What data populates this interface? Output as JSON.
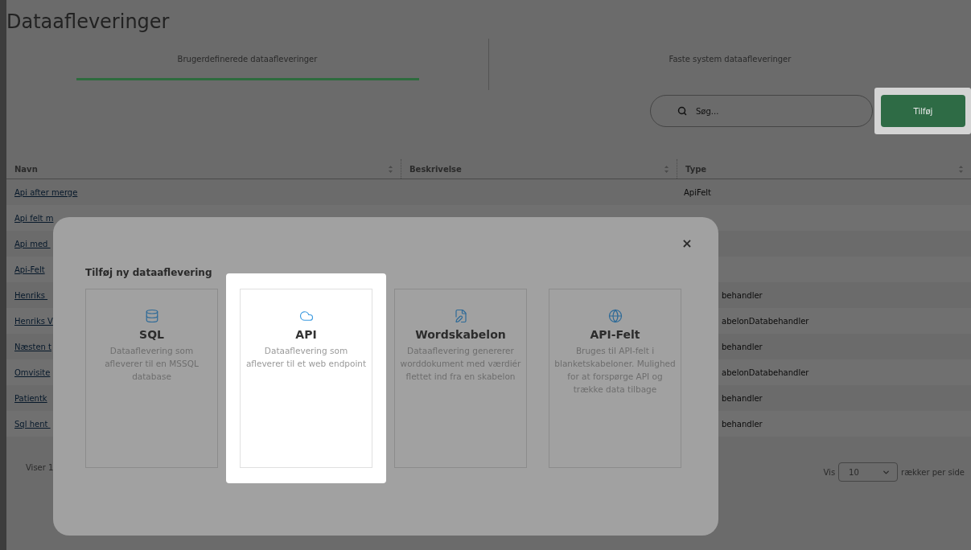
{
  "page": {
    "title": "Dataafleveringer"
  },
  "tabs": [
    {
      "label": "Brugerdefinerede dataafleveringer",
      "selected": true
    },
    {
      "label": "Faste system dataafleveringer",
      "selected": false
    }
  ],
  "search": {
    "placeholder": "Søg..."
  },
  "add_button": {
    "label": "Tilføj",
    "highlighted": true
  },
  "table": {
    "columns": [
      "Navn",
      "Beskrivelse",
      "Type"
    ],
    "rows": [
      {
        "name": "Api after merge",
        "type": "ApiFelt",
        "type_cut": false
      },
      {
        "name": "Api felt m"
      },
      {
        "name": "Api med "
      },
      {
        "name": "Api-Felt"
      },
      {
        "name": "Henriks ",
        "type": "behandler",
        "type_cut": true
      },
      {
        "name": "Henriks V",
        "type": "abelonDatabehandler",
        "type_cut": true
      },
      {
        "name": "Næsten t",
        "type": "behandler",
        "type_cut": true
      },
      {
        "name": "Omvisite",
        "type": "abelonDatabehandler",
        "type_cut": true
      },
      {
        "name": "Patientk",
        "type": "behandler",
        "type_cut": true
      },
      {
        "name": "Sql hent ",
        "type": "behandler",
        "type_cut": true
      }
    ]
  },
  "footer": {
    "showing": "Viser 1",
    "show_label": "Vis",
    "page_size": "10",
    "per_page_label": "rækker per side"
  },
  "dialog": {
    "title": "Tilføj ny dataaflevering",
    "close": "×",
    "options": [
      {
        "kind": "sql",
        "title": "SQL",
        "description": "Dataaflevering som afleverer til en MSSQL database",
        "highlighted": false
      },
      {
        "kind": "api",
        "title": "API",
        "description": "Dataaflevering som afleverer til et web endpoint",
        "highlighted": true
      },
      {
        "kind": "word",
        "title": "Wordskabelon",
        "description": "Dataaflevering genererer worddokument med værdiér flettet ind fra en skabelon",
        "highlighted": false
      },
      {
        "kind": "apifield",
        "title": "API-Felt",
        "description": "Bruges til API-felt i blanketskabeloner. Mulighed for at forspørge API og trække data tilbage",
        "highlighted": false
      }
    ]
  }
}
